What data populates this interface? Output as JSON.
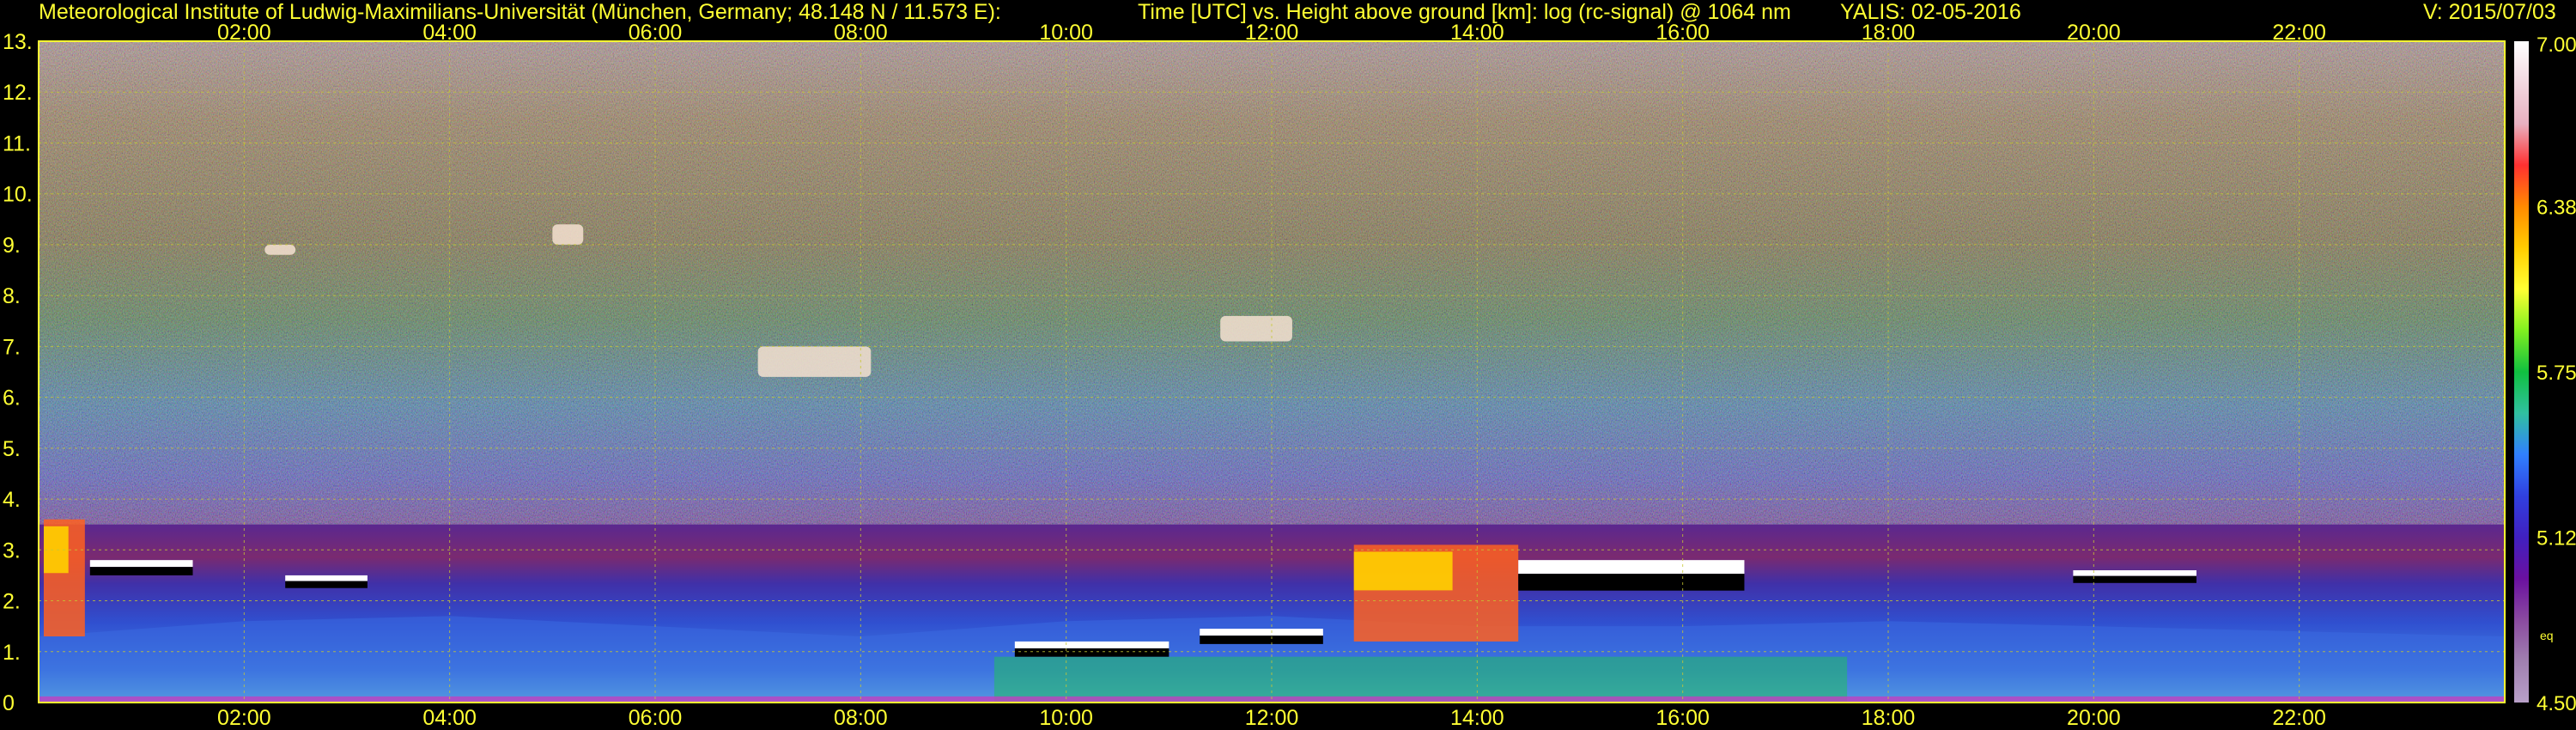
{
  "header": {
    "institute": "Meteorological Institute of Ludwig-Maximilians-Universität (München, Germany; 48.148 N / 11.573 E):",
    "title": "Time [UTC] vs. Height above ground [km]: log (rc-signal) @ 1064 nm",
    "station": "YALIS: 02-05-2016",
    "version": "V: 2015/07/03"
  },
  "chart_data": {
    "type": "heatmap",
    "title": "Time [UTC] vs. Height above ground [km]: log (rc-signal) @ 1064 nm",
    "xlabel": "Time [UTC]",
    "ylabel": "Height above ground [km]",
    "x_range_hours": [
      0,
      24
    ],
    "ylim": [
      0,
      13
    ],
    "x_tick_labels": [
      "02:00",
      "04:00",
      "06:00",
      "08:00",
      "10:00",
      "12:00",
      "14:00",
      "16:00",
      "18:00",
      "20:00",
      "22:00"
    ],
    "x_tick_hours": [
      2,
      4,
      6,
      8,
      10,
      12,
      14,
      16,
      18,
      20,
      22
    ],
    "y_tick_labels": [
      "0",
      "1.",
      "2.",
      "3.",
      "4.",
      "5.",
      "6.",
      "7.",
      "8.",
      "9.",
      "10.",
      "11.",
      "12.",
      "13."
    ],
    "y_tick_values": [
      0,
      1,
      2,
      3,
      4,
      5,
      6,
      7,
      8,
      9,
      10,
      11,
      12,
      13
    ],
    "grid": true,
    "colorbar": {
      "range": [
        4.5,
        7.0
      ],
      "tick_labels": [
        "7.00",
        "6.38",
        "5.75",
        "5.12",
        "4.50"
      ],
      "tick_values": [
        7.0,
        6.375,
        5.75,
        5.125,
        4.5
      ],
      "unit_label": "eq",
      "colors": [
        "#ffffff",
        "#f2d8e0",
        "#e8b0c0",
        "#ff3030",
        "#ff8a00",
        "#ffcc00",
        "#ffff33",
        "#80f020",
        "#10c040",
        "#30c0a0",
        "#3080ff",
        "#3040e0",
        "#4020c0",
        "#6a10a0",
        "#8a4aa0",
        "#a080b0",
        "#b8a0c8"
      ]
    },
    "features": {
      "boundary_layer_top_km": [
        {
          "hour": 0.0,
          "km": 1.3
        },
        {
          "hour": 2.0,
          "km": 1.6
        },
        {
          "hour": 4.0,
          "km": 1.7
        },
        {
          "hour": 6.0,
          "km": 1.5
        },
        {
          "hour": 8.0,
          "km": 1.3
        },
        {
          "hour": 10.0,
          "km": 1.6
        },
        {
          "hour": 12.0,
          "km": 1.7
        },
        {
          "hour": 14.0,
          "km": 1.5
        },
        {
          "hour": 16.0,
          "km": 1.5
        },
        {
          "hour": 18.0,
          "km": 1.6
        },
        {
          "hour": 20.0,
          "km": 1.5
        },
        {
          "hour": 22.0,
          "km": 1.4
        },
        {
          "hour": 24.0,
          "km": 1.3
        }
      ],
      "cloud_layers": [
        {
          "start_hour": 0.05,
          "end_hour": 0.45,
          "base_km": 1.3,
          "top_km": 3.6
        },
        {
          "start_hour": 0.5,
          "end_hour": 1.5,
          "base_km": 2.5,
          "top_km": 2.8
        },
        {
          "start_hour": 2.4,
          "end_hour": 3.2,
          "base_km": 2.25,
          "top_km": 2.5
        },
        {
          "start_hour": 9.5,
          "end_hour": 11.0,
          "base_km": 0.9,
          "top_km": 1.2
        },
        {
          "start_hour": 11.3,
          "end_hour": 12.5,
          "base_km": 1.15,
          "top_km": 1.45
        },
        {
          "start_hour": 12.8,
          "end_hour": 14.4,
          "base_km": 1.2,
          "top_km": 3.1
        },
        {
          "start_hour": 14.4,
          "end_hour": 16.6,
          "base_km": 2.2,
          "top_km": 2.8
        },
        {
          "start_hour": 19.8,
          "end_hour": 21.0,
          "base_km": 2.35,
          "top_km": 2.6
        },
        {
          "start_hour": 7.0,
          "end_hour": 8.1,
          "base_km": 6.4,
          "top_km": 7.0
        },
        {
          "start_hour": 11.5,
          "end_hour": 12.2,
          "base_km": 7.1,
          "top_km": 7.6
        },
        {
          "start_hour": 2.2,
          "end_hour": 2.5,
          "base_km": 8.8,
          "top_km": 9.0
        },
        {
          "start_hour": 5.0,
          "end_hour": 5.3,
          "base_km": 9.0,
          "top_km": 9.4
        }
      ]
    }
  }
}
